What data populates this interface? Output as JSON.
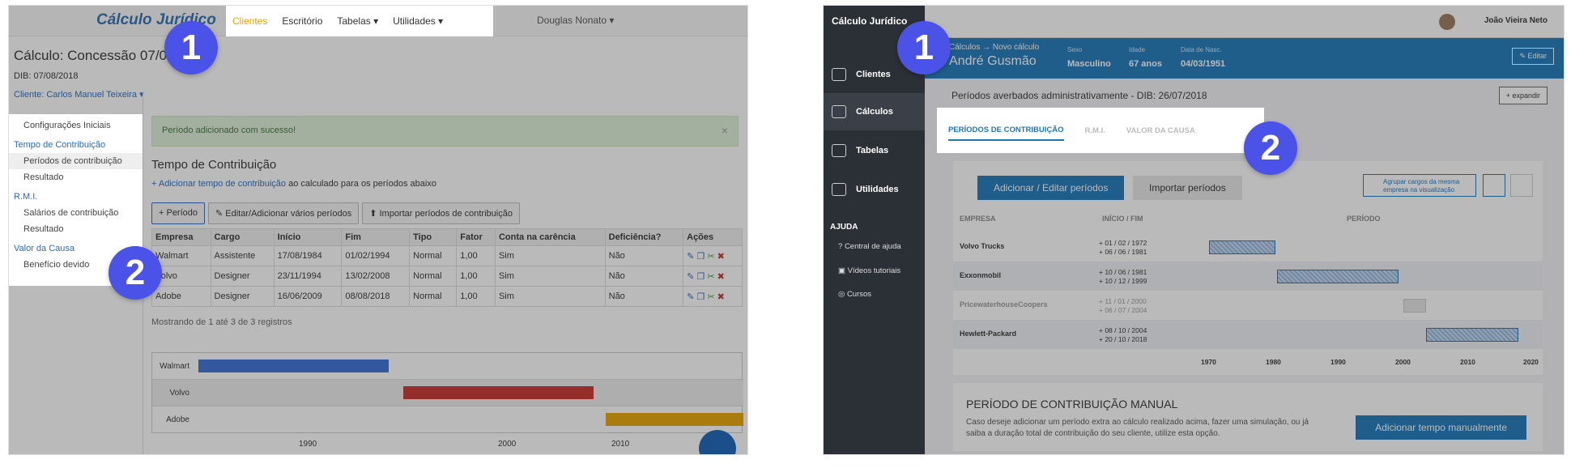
{
  "left": {
    "logo": "Cálculo Jurídico",
    "nav": [
      "Clientes",
      "Escritório",
      "Tabelas ▾",
      "Utilidades ▾"
    ],
    "user": "Douglas Nonato ▾",
    "title": "Cálculo: Concessão 07/0",
    "dib": "DIB: 07/08/2018",
    "client": "Cliente: Carlos Manuel Teixeira ▾",
    "sidebar": {
      "s0": "Configurações Iniciais",
      "h1": "Tempo de Contribuição",
      "i1": "Períodos de contribuição",
      "i2": "Resultado",
      "h2": "R.M.I.",
      "i3": "Salários de contribuição",
      "i4": "Resultado",
      "h3": "Valor da Causa",
      "i5": "Benefício devido"
    },
    "alert": "Período adicionado com sucesso!",
    "section": "Tempo de Contribuição",
    "add_link": "+ Adicionar tempo de contribuição",
    "add_rest": " ao calculado para os períodos abaixo",
    "buttons": [
      "+ Período",
      "✎ Editar/Adicionar vários períodos",
      "⬆ Importar períodos de contribuição"
    ],
    "headers": [
      "Empresa",
      "Cargo",
      "Início",
      "Fim",
      "Tipo",
      "Fator",
      "Conta na carência",
      "Deficiência?",
      "Ações"
    ],
    "rows": [
      [
        "Walmart",
        "Assistente",
        "17/08/1984",
        "01/02/1994",
        "Normal",
        "1,00",
        "Sim",
        "Não"
      ],
      [
        "Volvo",
        "Designer",
        "23/11/1994",
        "13/02/2008",
        "Normal",
        "1,00",
        "Sim",
        "Não"
      ],
      [
        "Adobe",
        "Designer",
        "16/06/2009",
        "08/08/2018",
        "Normal",
        "1,00",
        "Sim",
        "Não"
      ]
    ],
    "showing": "Mostrando de 1 até 3 de 3 registros",
    "gantt_labels": [
      "Walmart",
      "Volvo",
      "Adobe"
    ],
    "ticks": [
      "1990",
      "2000",
      "2010"
    ]
  },
  "right": {
    "logo": "Cálculo Jurídico",
    "menu": [
      "Clientes",
      "Cálculos",
      "Tabelas",
      "Utilidades"
    ],
    "help_title": "AJUDA",
    "help": [
      "Central de ajuda",
      "Vídeos tutoriais",
      "Cursos"
    ],
    "user": "João Vieira Neto",
    "breadcrumb": "Cálculos → Novo cálculo",
    "person": "André Gusmão",
    "fields": [
      {
        "k": "Sexo",
        "v": "Masculino"
      },
      {
        "k": "Idade",
        "v": "67 anos"
      },
      {
        "k": "Data de Nasc.",
        "v": "04/03/1951"
      }
    ],
    "edit": "✎ Editar",
    "page_title": "Períodos averbados administrativamente - DIB: 26/07/2018",
    "expand": "+ expandir",
    "tabs": [
      "PERÍODOS DE CONTRIBUIÇÃO",
      "R.M.I.",
      "VALOR DA CAUSA"
    ],
    "btn_add": "Adicionar / Editar períodos",
    "btn_import": "Importar períodos",
    "group": "Agrupar cargos da mesma empresa na visualização",
    "col_heads": [
      "EMPRESA",
      "INÍCIO / FIM",
      "PERÍODO"
    ],
    "entries": [
      {
        "name": "Volvo Trucks",
        "d1": "+ 01 / 02 / 1972",
        "d2": "+ 06 / 06 / 1981"
      },
      {
        "name": "Exxonmobil",
        "d1": "+ 10 / 06 / 1981",
        "d2": "+ 10 / 12 / 1999"
      },
      {
        "name": "PricewaterhouseCoopers",
        "d1": "+ 11 / 01 / 2000",
        "d2": "+ 06 / 07 / 2004"
      },
      {
        "name": "Hewlett-Packard",
        "d1": "+ 08 / 10 / 2004",
        "d2": "+ 20 / 10 / 2018"
      }
    ],
    "years": [
      "1970",
      "1980",
      "1990",
      "2000",
      "2010",
      "2020"
    ],
    "manual_title": "PERÍODO DE CONTRIBUIÇÃO MANUAL",
    "manual_text": "Caso deseje adicionar um período extra ao cálculo realizado acima, fazer uma simulação, ou já saiba a duração total de contribuição do seu cliente, utilize esta opção.",
    "manual_btn": "Adicionar tempo manualmente"
  },
  "badges": [
    "1",
    "2",
    "1",
    "2"
  ],
  "colors": {
    "walmart": "#3a6fd8",
    "volvo": "#c9302c",
    "adobe": "#e8a400",
    "badge": "#4a52e8",
    "brand": "#1b78b8"
  }
}
